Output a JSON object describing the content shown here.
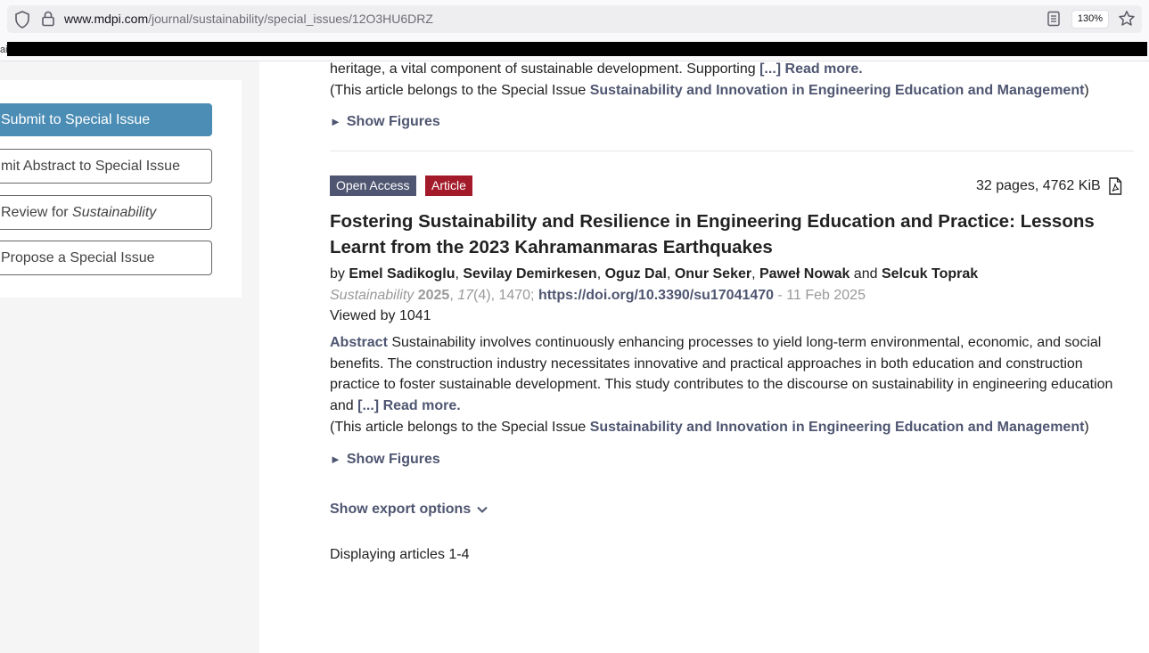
{
  "browser": {
    "url_host": "www.mdpi.com",
    "url_path": "/journal/sustainability/special_issues/12O3HU6DRZ",
    "zoom": "130%",
    "bookmark_fragment": "ai"
  },
  "sidebar": {
    "buttons": [
      {
        "label": "Submit to Special Issue"
      },
      {
        "label": "mit Abstract to Special Issue"
      },
      {
        "label_prefix": "Review for ",
        "label_em": "Sustainability"
      },
      {
        "label": "Propose a Special Issue"
      }
    ]
  },
  "prev_article": {
    "abstract_tail": "heritage, a vital component of sustainable development. Supporting ",
    "read_more": "[...] Read more.",
    "belongs_prefix": "(This article belongs to the Special Issue ",
    "special_issue": "Sustainability and Innovation in Engineering Education and Management",
    "belongs_suffix": ")",
    "show_figures": "Show Figures"
  },
  "article": {
    "badge_open_access": "Open Access",
    "badge_type": "Article",
    "pages_size": "32 pages, 4762 KiB",
    "title": "Fostering Sustainability and Resilience in Engineering Education and Practice: Lessons Learnt from the 2023 Kahramanmaras Earthquakes",
    "by": "by ",
    "authors": [
      "Emel Sadikoglu",
      "Sevilay Demirkesen",
      "Oguz Dal",
      "Onur Seker",
      "Paweł Nowak",
      "Selcuk Toprak"
    ],
    "and": " and ",
    "journal": "Sustainability",
    "year": "2025",
    "volume": "17",
    "issue_article": "(4), 1470; ",
    "doi": "https://doi.org/10.3390/su17041470",
    "date": " - 11 Feb 2025",
    "viewed": "Viewed by 1041",
    "abstract_label": "Abstract",
    "abstract_text": " Sustainability involves continuously enhancing processes to yield long-term environmental, economic, and social benefits. The construction industry necessitates innovative and practical approaches in both education and construction practice to foster sustainable development. This study contributes to the discourse on sustainability in engineering education and ",
    "read_more": "[...] Read more.",
    "belongs_prefix": "(This article belongs to the Special Issue ",
    "special_issue": "Sustainability and Innovation in Engineering Education and Management",
    "belongs_suffix": ")",
    "show_figures": "Show Figures"
  },
  "footer": {
    "export_label": "Show export options",
    "displaying": "Displaying articles 1-4"
  },
  "colors": {
    "link": "#4f5671",
    "primary_button": "#4c8db5",
    "article_badge": "#a31b2a"
  }
}
